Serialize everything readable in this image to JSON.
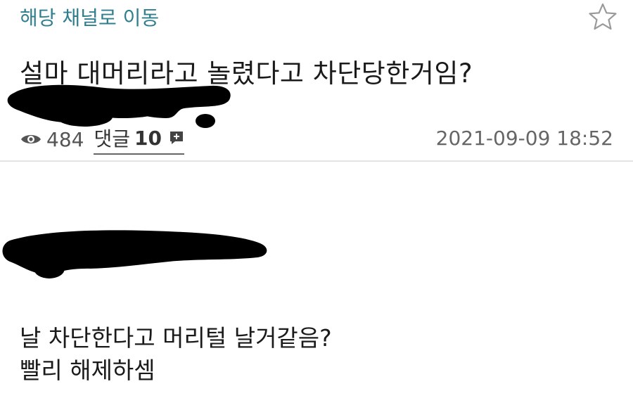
{
  "header": {
    "channel_link": "해당 채널로 이동",
    "favorite_icon": "star-outline-icon"
  },
  "post": {
    "title": "설마 대머리라고 놀렸다고 차단당한거임?",
    "views": "484",
    "comments_label": "댓글",
    "comments_count": "10",
    "timestamp": "2021-09-09 18:52"
  },
  "content": {
    "lines": [
      "날 차단한다고 머리털 날거같음?",
      "빨리 해제하셈"
    ]
  },
  "colors": {
    "link": "#2f7f8f",
    "text": "#1a1a1a",
    "meta": "#555555",
    "divider": "#e4e4e4",
    "redaction": "#000000"
  }
}
